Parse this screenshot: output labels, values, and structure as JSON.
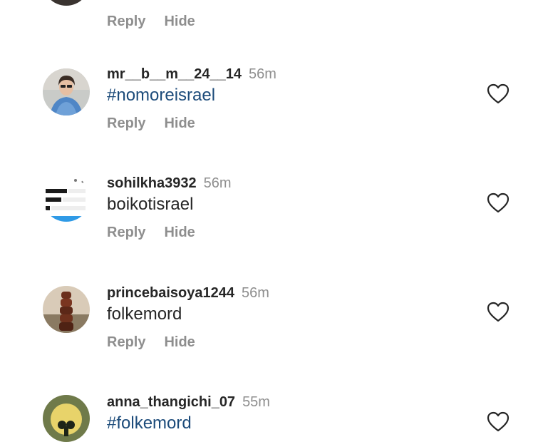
{
  "actions": {
    "reply_label": "Reply",
    "hide_label": "Hide"
  },
  "comments": [
    {
      "username": "mr__b__m__24__14",
      "time": "56m",
      "text": "#nomoreisrael",
      "is_hashtag": true,
      "avatar": "avatar-person-icon"
    },
    {
      "username": "sohilkha3932",
      "time": "56m",
      "text": "boikotisrael",
      "is_hashtag": false,
      "avatar": "avatar-screenshot-icon"
    },
    {
      "username": "princebaisoya1244",
      "time": "56m",
      "text": "folkemord",
      "is_hashtag": false,
      "avatar": "avatar-stacked-stones-icon"
    },
    {
      "username": "anna_thangichi_07",
      "time": "55m",
      "text": "#folkemord",
      "is_hashtag": true,
      "avatar": "avatar-moon-icon"
    }
  ],
  "icons": {
    "like": "heart-outline-icon"
  },
  "colors": {
    "hashtag": "#1c4b7a",
    "username": "#262626",
    "muted": "#8e8e8e"
  }
}
